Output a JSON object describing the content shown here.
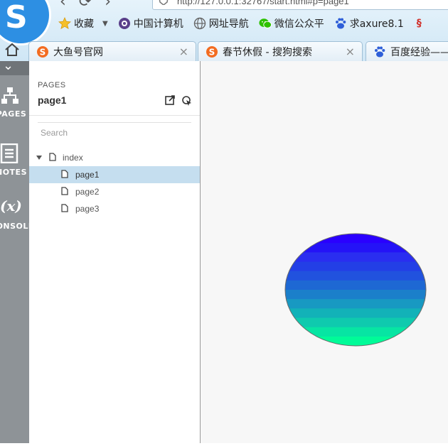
{
  "browser": {
    "address_text": "http://127.0.0.1:32767/start.html#p=page1",
    "bookmarks": [
      {
        "label": "收藏",
        "icon": "star-icon"
      },
      {
        "label": "中国计算机",
        "icon": "circle-eye-icon"
      },
      {
        "label": "网址导航",
        "icon": "globe-icon"
      },
      {
        "label": "微信公众平",
        "icon": "wechat-icon"
      },
      {
        "label": "求axure8.1",
        "icon": "baidu-paw-icon"
      }
    ],
    "tabs": [
      {
        "label": "大鱼号官网",
        "close": "×",
        "icon": "sogou-icon"
      },
      {
        "label": "春节休假 - 搜狗搜索",
        "close": "×",
        "icon": "sogou-icon"
      },
      {
        "label": "百度经验——",
        "icon": "baidu-paw-icon"
      }
    ]
  },
  "sidebar_rail": {
    "items": [
      {
        "label": "PAGES",
        "icon": "sitemap-icon"
      },
      {
        "label": "NOTES",
        "icon": "notes-icon"
      },
      {
        "label": "CONSOLE",
        "icon": "variable-icon",
        "glyph": "(x)"
      }
    ]
  },
  "pages_panel": {
    "heading": "PAGES",
    "current_page": "page1",
    "search_placeholder": "Search",
    "tree": {
      "root": "index",
      "children": [
        {
          "label": "page1",
          "selected": true
        },
        {
          "label": "page2",
          "selected": false
        },
        {
          "label": "page3",
          "selected": false
        }
      ]
    }
  },
  "canvas": {
    "shape": "ellipse",
    "fill_colors_top_to_bottom": [
      "#2a00ff",
      "#2413f7",
      "#2a2ef0",
      "#233fe6",
      "#2152de",
      "#1e68d3",
      "#1b7fca",
      "#1899c2",
      "#12b2b8",
      "#0fcaae",
      "#07e5a3",
      "#00fb98"
    ],
    "stroke_color": "#6a6a6a"
  }
}
